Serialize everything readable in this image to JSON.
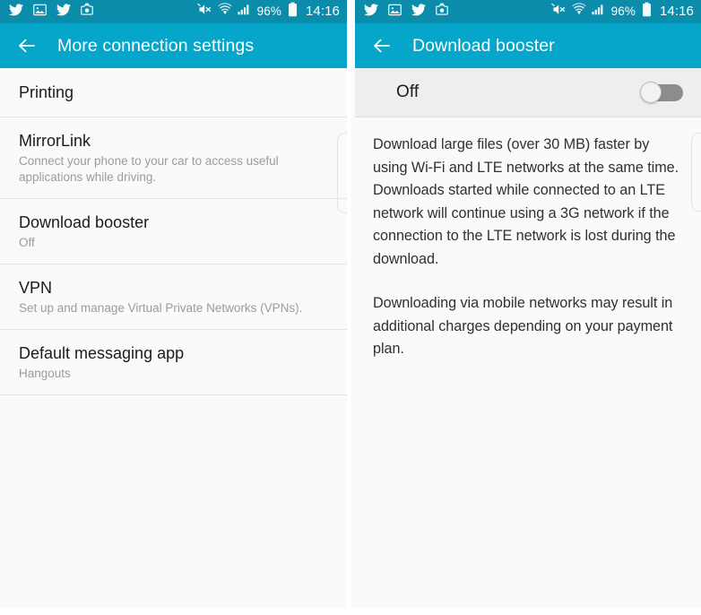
{
  "status_bar": {
    "notification_icons": [
      "twitter-icon",
      "image-icon",
      "twitter-icon",
      "screenshot-icon"
    ],
    "mute_icon": "mute-icon",
    "wifi_icon": "wifi-icon",
    "signal_icon": "signal-icon",
    "battery_percent": "96%",
    "battery_icon": "battery-icon",
    "clock": "14:16",
    "background_color": "#0b8cab"
  },
  "theme": {
    "accent": "#06a5ca",
    "statusbar": "#0b8cab",
    "panel_bg": "#fafafa",
    "toggle_row_bg": "#eeeeee",
    "title_color": "#1b1b1b",
    "subtitle_color": "#9b9b9b",
    "body_color": "#303030"
  },
  "left_panel": {
    "back_icon": "back-arrow-icon",
    "title": "More connection settings",
    "items": [
      {
        "title": "Printing",
        "subtitle": ""
      },
      {
        "title": "MirrorLink",
        "subtitle": "Connect your phone to your car to access useful applications while driving."
      },
      {
        "title": "Download booster",
        "subtitle": "Off"
      },
      {
        "title": "VPN",
        "subtitle": "Set up and manage Virtual Private Networks (VPNs)."
      },
      {
        "title": "Default messaging app",
        "subtitle": "Hangouts"
      }
    ]
  },
  "right_panel": {
    "back_icon": "back-arrow-icon",
    "title": "Download booster",
    "toggle": {
      "label": "Off",
      "state": "off"
    },
    "paragraphs": [
      "Download large files (over 30 MB) faster by using Wi-Fi and LTE networks at the same time. Downloads started while connected to an LTE network will continue using a 3G network if the connection to the LTE network is lost during the download.",
      "Downloading via mobile networks may result in additional charges depending on your payment plan."
    ]
  }
}
